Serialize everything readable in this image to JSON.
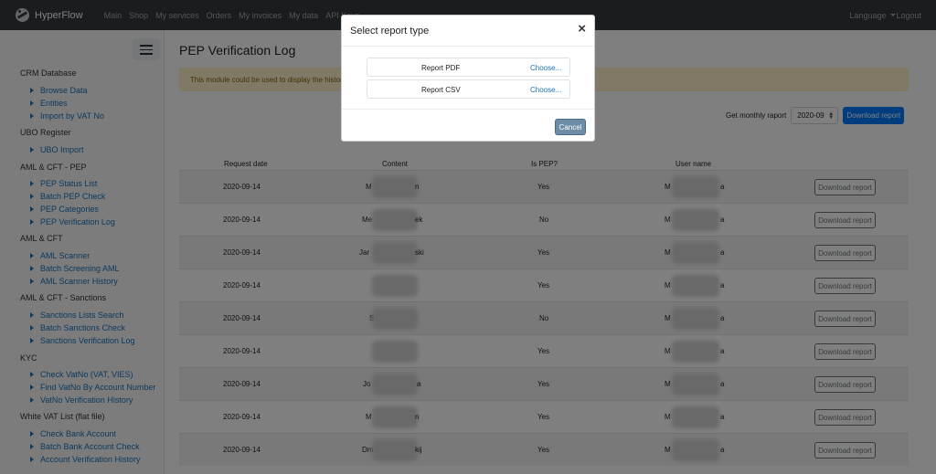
{
  "navbar": {
    "brand": "HyperFlow",
    "links": [
      "Main",
      "Shop",
      "My services",
      "Orders",
      "My invoices",
      "My data",
      "API Keys"
    ],
    "language": "Language",
    "logout": "Logout"
  },
  "sidebar": {
    "sections": [
      {
        "title": "CRM Database",
        "items": [
          "Browse Data",
          "Entities",
          "Import by VAT No"
        ]
      },
      {
        "title": "UBO Register",
        "items": [
          "UBO Import"
        ]
      },
      {
        "title": "AML & CFT - PEP",
        "items": [
          "PEP Status List",
          "Batch PEP Check",
          "PEP Categories",
          "PEP Verification Log"
        ]
      },
      {
        "title": "AML & CFT",
        "items": [
          "AML Scanner",
          "Batch Screening AML",
          "AML Scanner History"
        ]
      },
      {
        "title": "AML & CFT - Sanctions",
        "items": [
          "Sanctions Lists Search",
          "Batch Sanctions Check",
          "Sanctions Verification Log"
        ]
      },
      {
        "title": "KYC",
        "items": [
          "Check VatNo (VAT, VIES)",
          "Find VatNo By Account Number",
          "VatNo Verification History"
        ]
      },
      {
        "title": "White VAT List (flat file)",
        "items": [
          "Check Bank Account",
          "Batch Bank Account Check",
          "Account Verification History"
        ]
      }
    ]
  },
  "main": {
    "title": "PEP Verification Log",
    "alert": "This module could be used to display the history",
    "monthly_label": "Get monthly raport",
    "month_value": "2020-09",
    "download_monthly": "Download report"
  },
  "table": {
    "headers": [
      "Request date",
      "Content",
      "Is PEP?",
      "User name"
    ],
    "rows": [
      {
        "date": "2020-09-14",
        "content_start": "M",
        "content_end": "n",
        "pep": "Yes",
        "user_start": "M",
        "user_end": "a"
      },
      {
        "date": "2020-09-14",
        "content_start": "Me",
        "content_end": "ek",
        "pep": "No",
        "user_start": "M",
        "user_end": "a"
      },
      {
        "date": "2020-09-14",
        "content_start": "Jar",
        "content_end": "ski",
        "pep": "Yes",
        "user_start": "M",
        "user_end": "a"
      },
      {
        "date": "2020-09-14",
        "content_start": "",
        "content_end": "",
        "pep": "Yes",
        "user_start": "M",
        "user_end": "a"
      },
      {
        "date": "2020-09-14",
        "content_start": "S",
        "content_end": "",
        "pep": "No",
        "user_start": "M",
        "user_end": "a"
      },
      {
        "date": "2020-09-14",
        "content_start": "",
        "content_end": "",
        "pep": "Yes",
        "user_start": "M",
        "user_end": "a"
      },
      {
        "date": "2020-09-14",
        "content_start": "Jo",
        "content_end": "a",
        "pep": "Yes",
        "user_start": "M",
        "user_end": "a"
      },
      {
        "date": "2020-09-14",
        "content_start": "M",
        "content_end": "n",
        "pep": "Yes",
        "user_start": "M",
        "user_end": "a"
      },
      {
        "date": "2020-09-14",
        "content_start": "Dm",
        "content_end": "kij",
        "pep": "Yes",
        "user_start": "M",
        "user_end": "a"
      }
    ],
    "row_button": "Download report"
  },
  "modal": {
    "title": "Select report type",
    "close": "×",
    "options": [
      {
        "name": "Report PDF",
        "action": "Choose..."
      },
      {
        "name": "Report CSV",
        "action": "Choose..."
      }
    ],
    "cancel": "Cancel"
  }
}
